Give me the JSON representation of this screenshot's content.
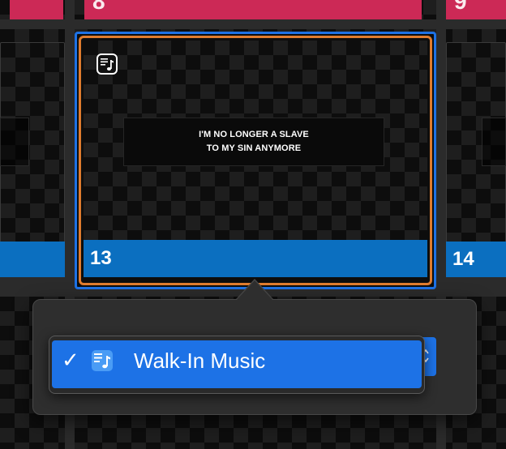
{
  "top_row": {
    "left_number": "8",
    "right_number": "9"
  },
  "slides": {
    "selected": {
      "number": "13",
      "text": "I'M NO LONGER A SLAVE\nTO MY SIN ANYMORE",
      "badge_icon": "music-note-icon"
    },
    "right": {
      "number": "14"
    }
  },
  "popover": {
    "menu_item": {
      "checkmark": "✓",
      "icon": "playlist-music-icon",
      "label": "Walk-In Music"
    }
  },
  "colors": {
    "accent_blue": "#1d72e6",
    "label_blue": "#0b6fc0",
    "selection_orange": "#e07c2e",
    "magenta": "#cc2956"
  }
}
